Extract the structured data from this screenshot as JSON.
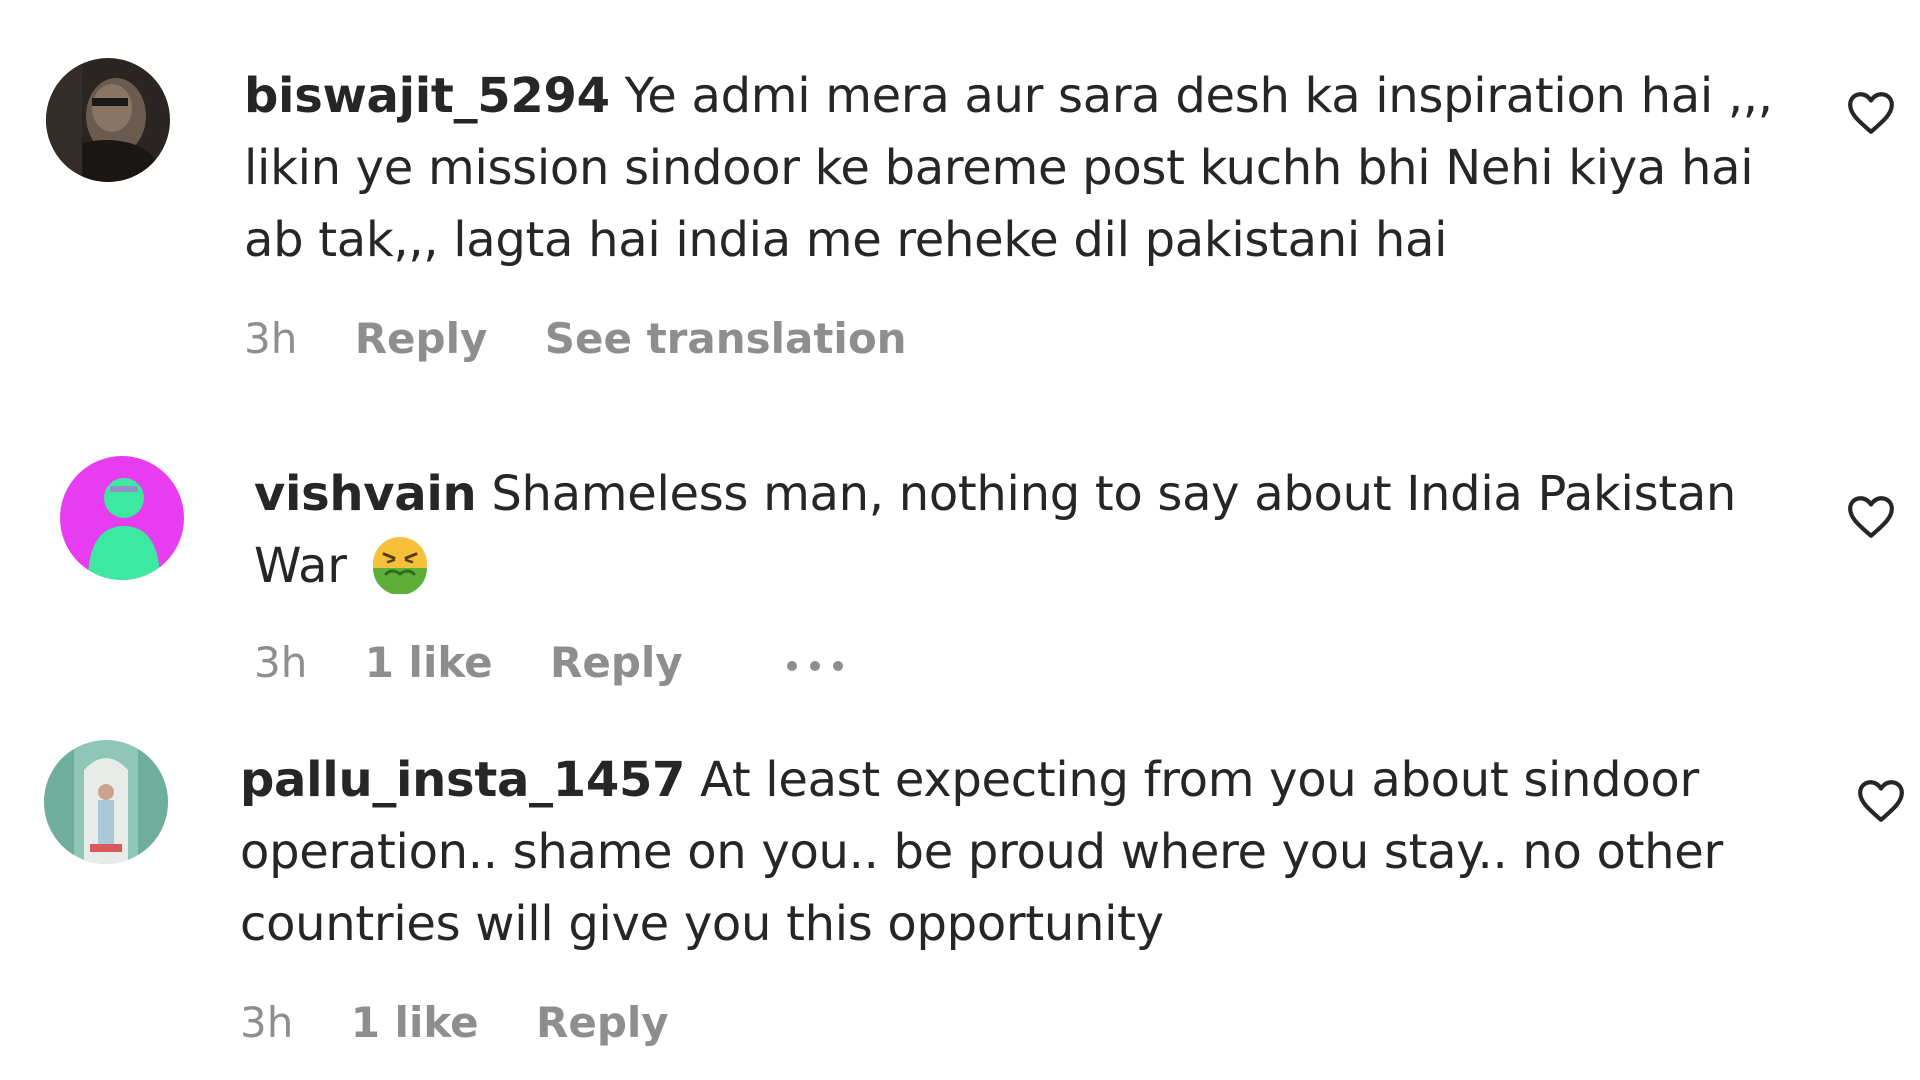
{
  "comments": [
    {
      "username": "biswajit_5294",
      "text": "Ye admi mera aur sara desh ka inspiration hai ,,, likin ye mission sindoor ke bareme post kuchh bhi Nehi kiya hai ab tak,,, lagta hai india me reheke dil pakistani hai",
      "time": "3h",
      "reply_label": "Reply",
      "translation_label": "See translation",
      "avatar_icon": "user-photo-avatar-icon"
    },
    {
      "username": "vishvain",
      "text": "Shameless man, nothing to say about India Pakistan War",
      "emoji_icon": "nauseated-face-emoji-icon",
      "time": "3h",
      "likes": "1 like",
      "reply_label": "Reply",
      "more_icon": "more-options-icon",
      "avatar_icon": "default-user-avatar-icon"
    },
    {
      "username": "pallu_insta_1457",
      "text": "At least expecting from you about sindoor operation.. shame on you.. be proud where you stay.. no other countries will give you this opportunity",
      "time": "3h",
      "likes": "1 like",
      "reply_label": "Reply",
      "avatar_icon": "user-photo-avatar-icon"
    }
  ],
  "icons": {
    "like": "heart-outline-icon"
  },
  "colors": {
    "text": "#262626",
    "secondary": "#8e8e8e",
    "avatar2_bg": "#e83cf0",
    "avatar2_figure": "#3de8a0"
  }
}
